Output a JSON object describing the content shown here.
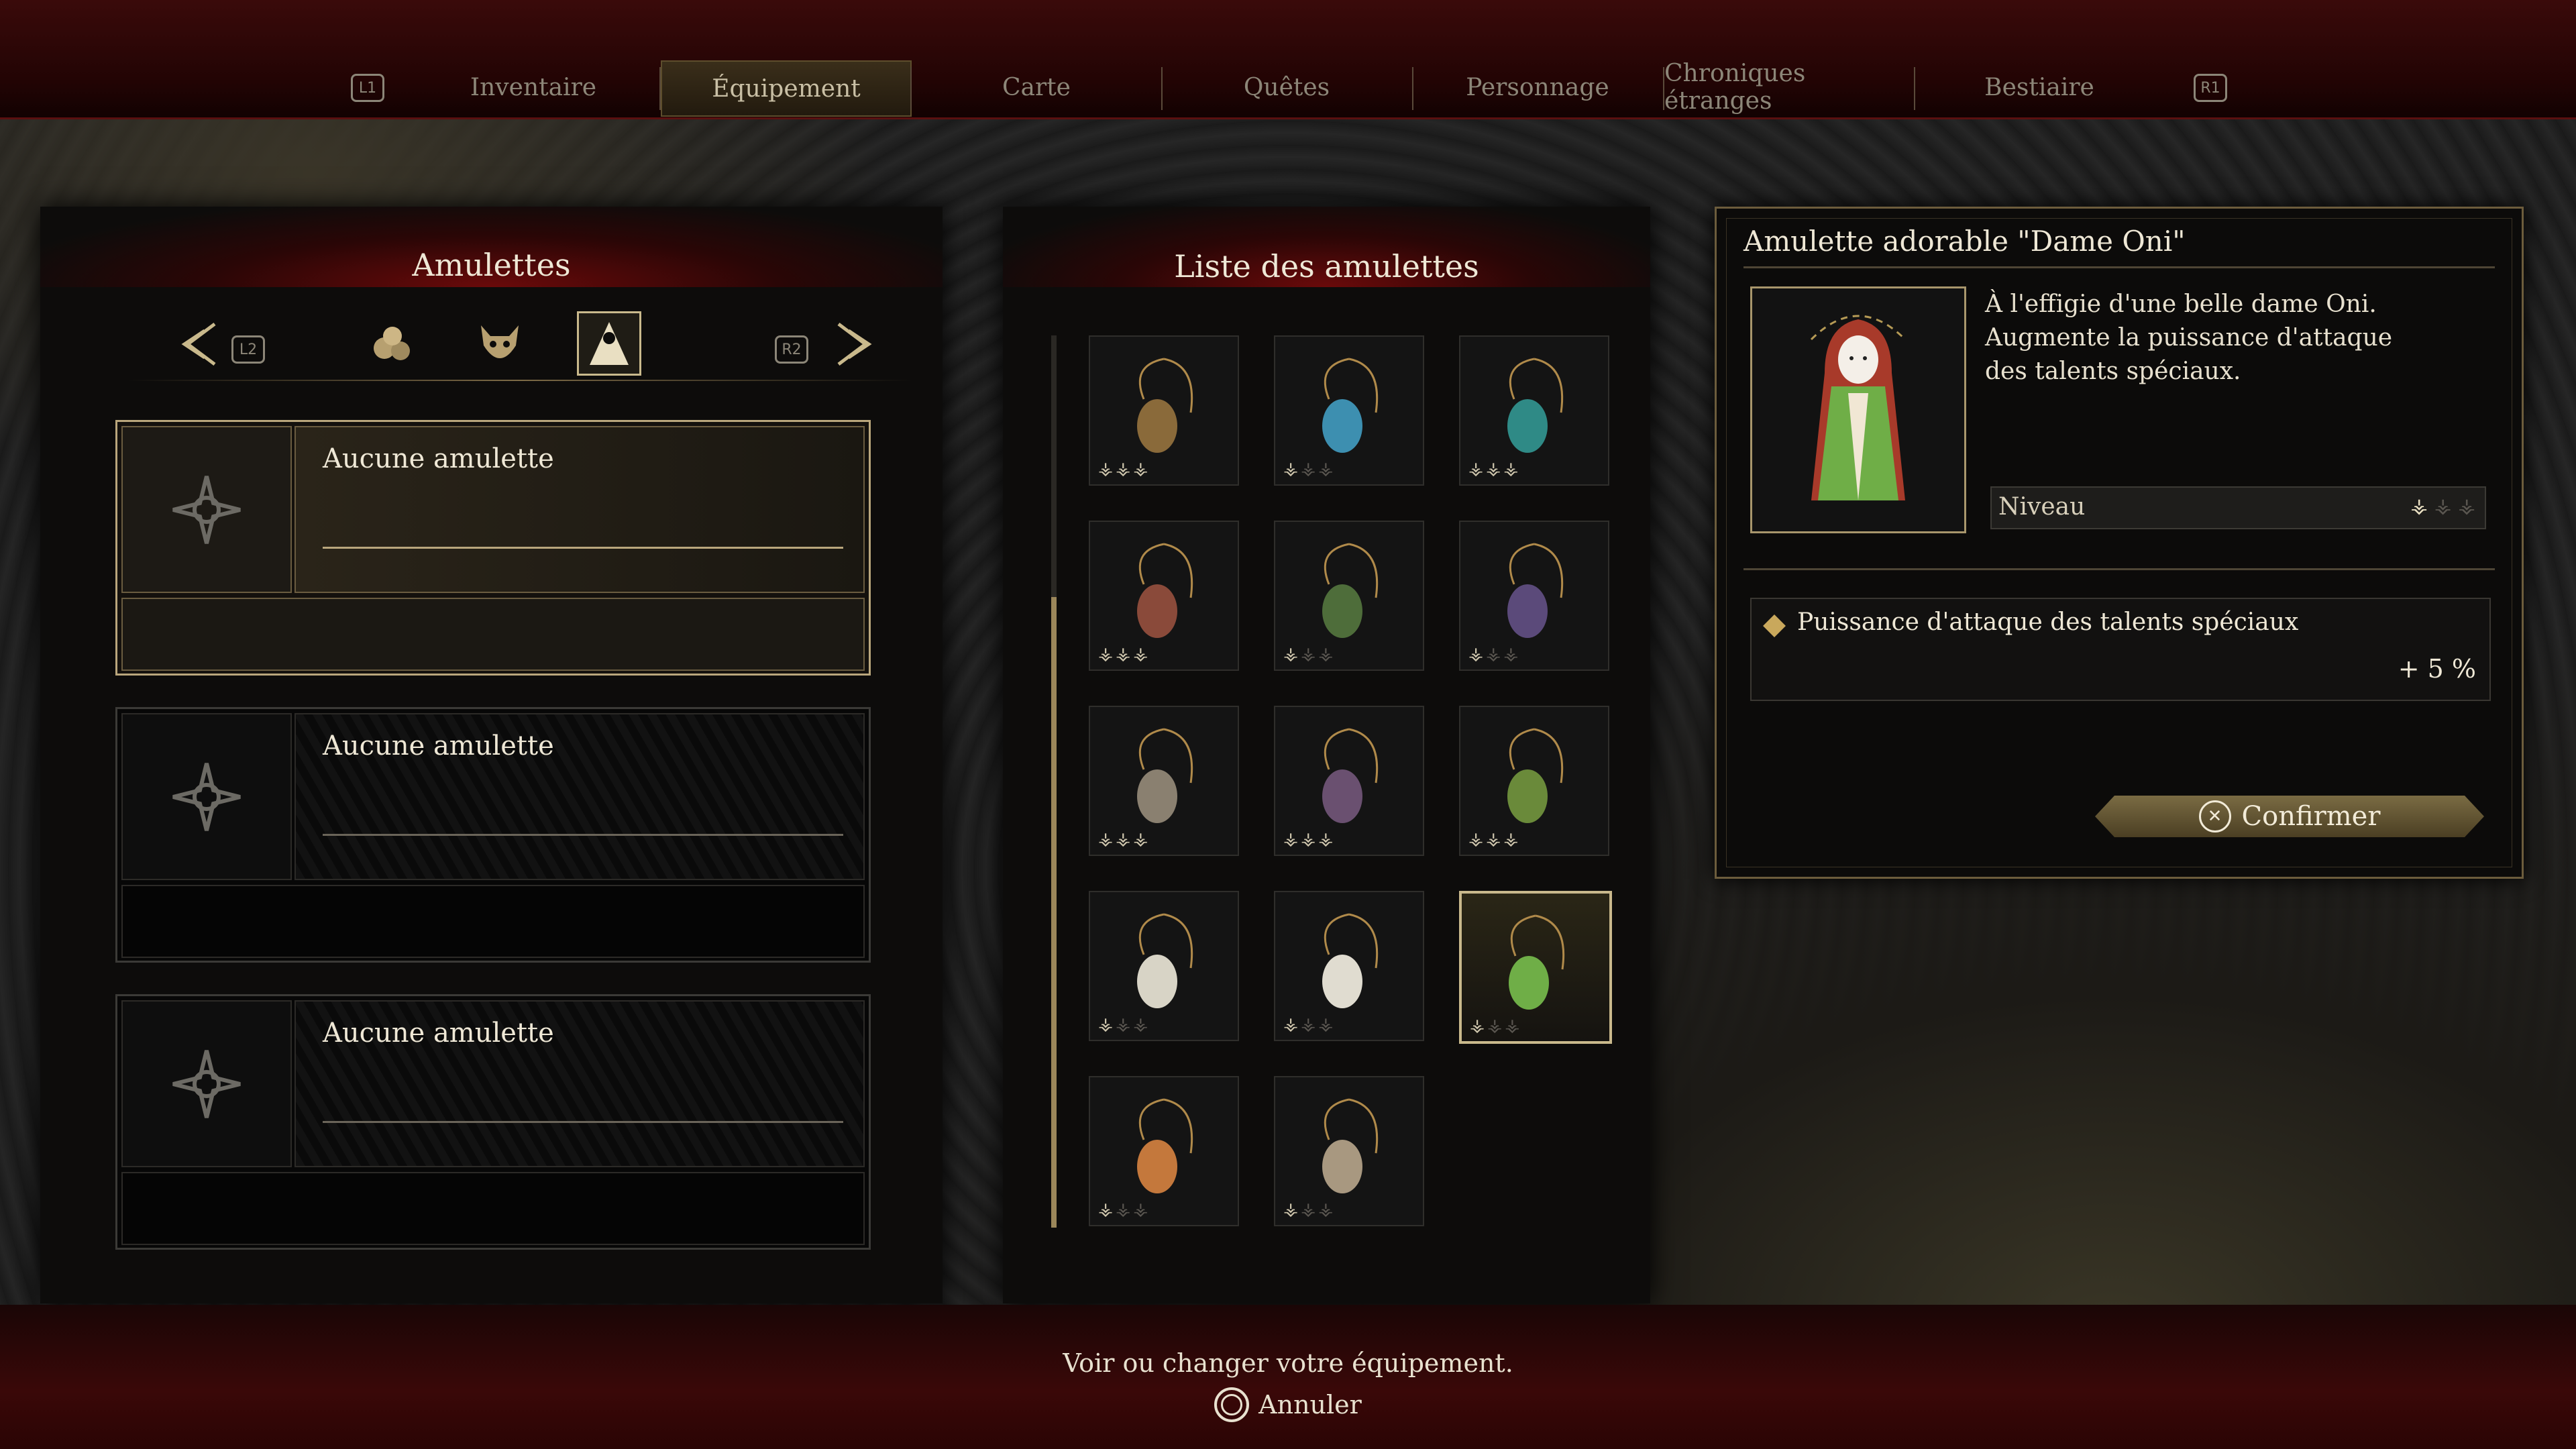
{
  "topbar": {
    "left_hint": "L1",
    "right_hint": "R1",
    "tabs": [
      {
        "label": "Inventaire"
      },
      {
        "label": "Équipement"
      },
      {
        "label": "Carte"
      },
      {
        "label": "Quêtes"
      },
      {
        "label": "Personnage"
      },
      {
        "label": "Chroniques étranges"
      },
      {
        "label": "Bestiaire"
      }
    ],
    "active_tab": "Équipement"
  },
  "left_panel": {
    "title": "Amulettes",
    "left_trigger": "L2",
    "right_trigger": "R2",
    "categories": [
      "fruit-cluster-icon",
      "oni-mask-icon",
      "dame-oni-icon"
    ],
    "active_category": "dame-oni-icon",
    "slots": [
      {
        "label": "Aucune amulette",
        "active": true
      },
      {
        "label": "Aucune amulette",
        "active": false
      },
      {
        "label": "Aucune amulette",
        "active": false
      }
    ]
  },
  "middle_panel": {
    "title": "Liste des amulettes",
    "items": [
      {
        "icon": "brown-pouch-amulet-icon",
        "level": 3,
        "max": 3
      },
      {
        "icon": "blue-crystal-amulet-icon",
        "level": 1,
        "max": 3
      },
      {
        "icon": "teal-orb-amulet-icon",
        "level": 3,
        "max": 3
      },
      {
        "icon": "red-fur-tassel-amulet-icon",
        "level": 3,
        "max": 3
      },
      {
        "icon": "green-fur-tassel-amulet-icon",
        "level": 1,
        "max": 3
      },
      {
        "icon": "purple-fur-tassel-amulet-icon",
        "level": 1,
        "max": 3
      },
      {
        "icon": "bone-charm-amulet-icon",
        "level": 3,
        "max": 3
      },
      {
        "icon": "purple-pouch-amulet-icon",
        "level": 3,
        "max": 3
      },
      {
        "icon": "swirl-emblem-amulet-icon",
        "level": 3,
        "max": 3
      },
      {
        "icon": "white-fox-amulet-icon",
        "level": 1,
        "max": 3
      },
      {
        "icon": "santa-doll-amulet-icon",
        "level": 1,
        "max": 3
      },
      {
        "icon": "dame-oni-amulet-icon",
        "level": 1,
        "max": 3,
        "selected": true
      },
      {
        "icon": "kimono-girl-amulet-icon",
        "level": 1,
        "max": 3
      },
      {
        "icon": "old-man-amulet-icon",
        "level": 1,
        "max": 3
      }
    ]
  },
  "detail": {
    "title": "Amulette adorable \"Dame Oni\"",
    "description_lines": [
      "À l'effigie d'une belle dame Oni.",
      "Augmente la puissance d'attaque",
      "des talents spéciaux."
    ],
    "level_label": "Niveau",
    "level": 1,
    "level_max": 3,
    "stat_label": "Puissance d'attaque des talents spéciaux",
    "stat_value": "+ 5 %",
    "confirm_label": "Confirmer",
    "confirm_icon": "cross-button-icon"
  },
  "footer": {
    "hint": "Voir ou changer votre équipement.",
    "cancel_label": "Annuler",
    "cancel_icon": "circle-button-icon"
  },
  "colors": {
    "gold": "#c9b98c",
    "crimson": "#5a1010",
    "text": "#efe8d6"
  }
}
